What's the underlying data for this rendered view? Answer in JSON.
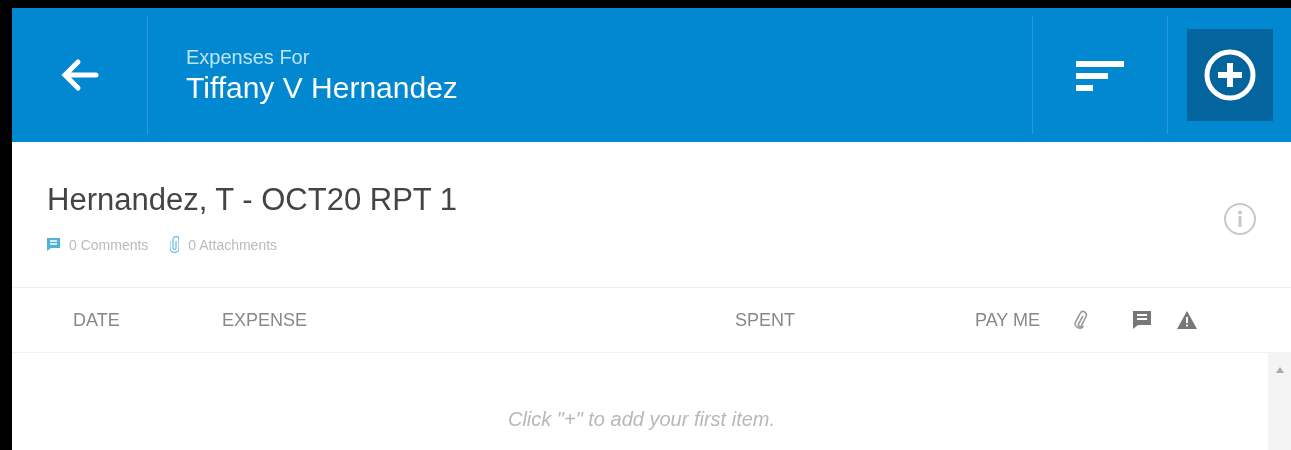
{
  "header": {
    "subtitle": "Expenses For",
    "title": "Tiffany V Hernandez"
  },
  "report": {
    "title": "Hernandez, T - OCT20 RPT 1",
    "comments": "0 Comments",
    "attachments": "0 Attachments"
  },
  "columns": [
    {
      "label": "DATE"
    },
    {
      "label": "EXPENSE"
    },
    {
      "label": "SPENT"
    },
    {
      "label": "PAY ME"
    }
  ],
  "empty_message": "Click \"+\" to add your first item."
}
